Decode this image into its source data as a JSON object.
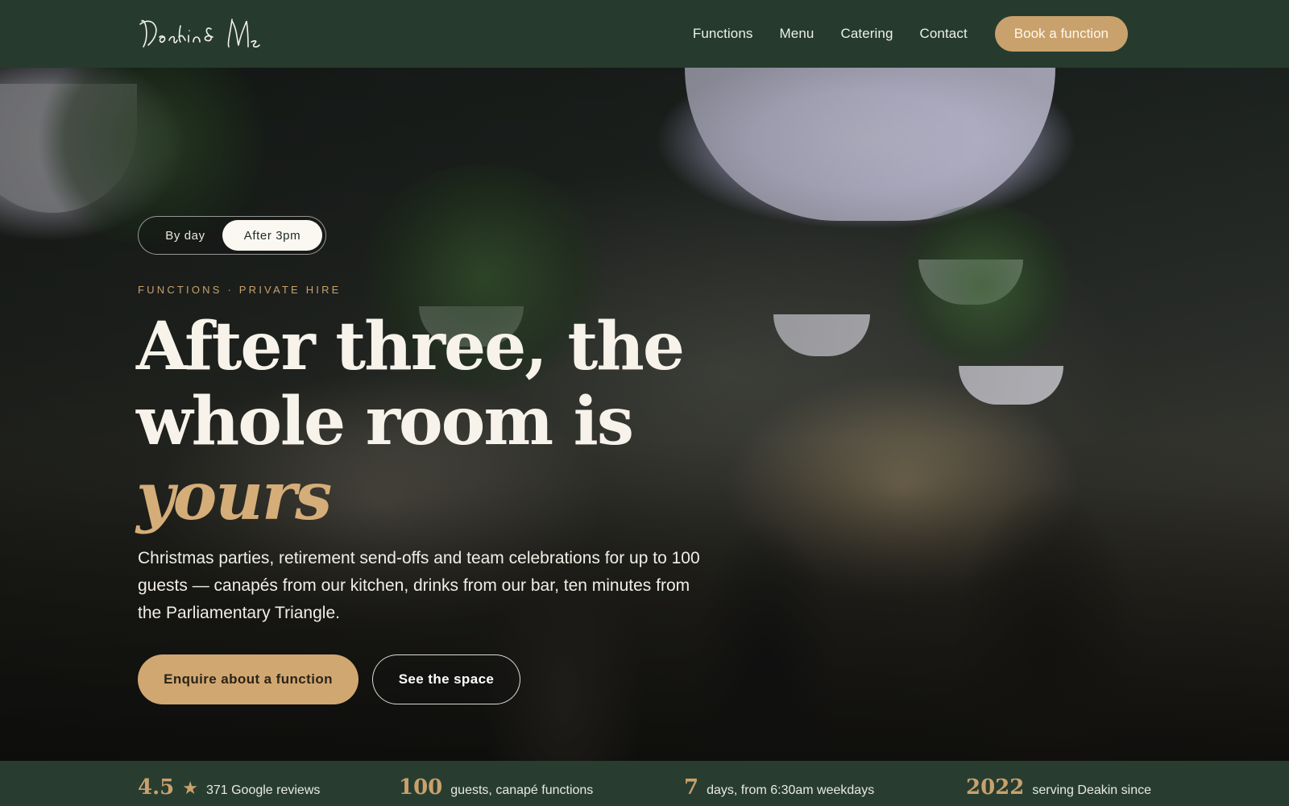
{
  "header": {
    "logo_text": "Deakin & Me",
    "nav": [
      "Functions",
      "Menu",
      "Catering",
      "Contact"
    ],
    "book_label": "Book a function"
  },
  "hero": {
    "toggle": {
      "day_label": "By day",
      "after_label": "After 3pm",
      "selected": "After 3pm"
    },
    "eyebrow": "FUNCTIONS · PRIVATE HIRE",
    "headline_line1": "After three, the",
    "headline_line2": "whole room is",
    "headline_accent": "yours",
    "lead": "Christmas parties, retirement send-offs and team celebrations for up to 100 guests — canapés from our kitchen, drinks from our bar, ten minutes from the Parliamentary Triangle.",
    "cta_primary": "Enquire about a function",
    "cta_secondary": "See the space"
  },
  "stats": [
    {
      "num": "4.5",
      "icon": "star-icon",
      "label": "371 Google reviews"
    },
    {
      "num": "100",
      "label": "guests, canapé functions"
    },
    {
      "num": "7",
      "label": "days, from 6:30am weekdays"
    },
    {
      "num": "2022",
      "label": "serving Deakin since"
    }
  ],
  "colors": {
    "header_bg": "#263b2e",
    "accent_gold": "#c9a16c",
    "stats_bg": "#283d30"
  }
}
